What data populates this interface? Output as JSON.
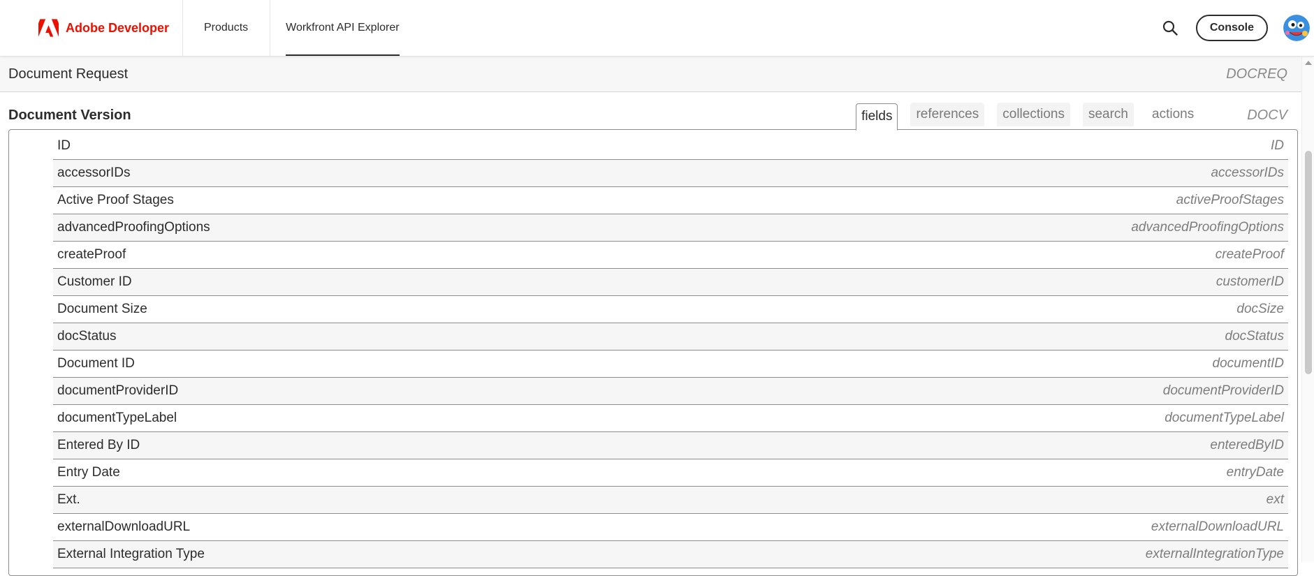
{
  "header": {
    "brand": "Adobe Developer",
    "nav": [
      {
        "label": "Products"
      },
      {
        "label": "Workfront API Explorer"
      }
    ],
    "console_label": "Console",
    "icons": {
      "search": "search-icon",
      "logo": "adobe-logo-icon",
      "avatar": "user-avatar"
    },
    "colors": {
      "brand": "#eb1000"
    }
  },
  "doc_request": {
    "label": "Document Request",
    "code": "DOCREQ"
  },
  "document_version": {
    "label": "Document Version",
    "code": "DOCV",
    "tabs": [
      {
        "label": "fields",
        "active": true
      },
      {
        "label": "references",
        "active": false
      },
      {
        "label": "collections",
        "active": false
      },
      {
        "label": "search",
        "active": false
      },
      {
        "label": "actions",
        "active": false
      }
    ],
    "fields": [
      {
        "name": "ID",
        "code": "ID"
      },
      {
        "name": "accessorIDs",
        "code": "accessorIDs"
      },
      {
        "name": "Active Proof Stages",
        "code": "activeProofStages"
      },
      {
        "name": "advancedProofingOptions",
        "code": "advancedProofingOptions"
      },
      {
        "name": "createProof",
        "code": "createProof"
      },
      {
        "name": "Customer ID",
        "code": "customerID"
      },
      {
        "name": "Document Size",
        "code": "docSize"
      },
      {
        "name": "docStatus",
        "code": "docStatus"
      },
      {
        "name": "Document ID",
        "code": "documentID"
      },
      {
        "name": "documentProviderID",
        "code": "documentProviderID"
      },
      {
        "name": "documentTypeLabel",
        "code": "documentTypeLabel"
      },
      {
        "name": "Entered By ID",
        "code": "enteredByID"
      },
      {
        "name": "Entry Date",
        "code": "entryDate"
      },
      {
        "name": "Ext.",
        "code": "ext"
      },
      {
        "name": "externalDownloadURL",
        "code": "externalDownloadURL"
      },
      {
        "name": "External Integration Type",
        "code": "externalIntegrationType"
      }
    ]
  }
}
